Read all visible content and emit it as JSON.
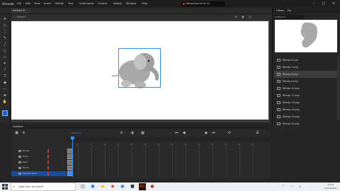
{
  "app": {
    "logo": "Animate",
    "menu": [
      "File",
      "Edit",
      "View",
      "Insert",
      "Modify",
      "Text",
      "Commands",
      "Control",
      "Debug",
      "Window",
      "Help"
    ],
    "recording": "Recording 00:01:11"
  },
  "document": {
    "tab_label": "Untitled-3*",
    "scene_label": "Scene 1"
  },
  "right_panel": {
    "tabs": [
      "Library",
      "Pro"
    ],
    "library_select": "Untitled-3",
    "items": [
      {
        "name": "Bitmap 6.png",
        "selected": false
      },
      {
        "name": "Bitmap 7.png",
        "selected": false
      },
      {
        "name": "Bitmap 8.png",
        "selected": true
      },
      {
        "name": "Bitmap 9.png",
        "selected": false
      },
      {
        "name": "Bitmap 10.png",
        "selected": false
      },
      {
        "name": "Bitmap 11.png",
        "selected": false
      },
      {
        "name": "Bitmap 12.png",
        "selected": false
      },
      {
        "name": "Bitmap 13.png",
        "selected": false
      },
      {
        "name": "Bitmap 14.png",
        "selected": false
      },
      {
        "name": "Bitmap 15.png",
        "selected": false
      }
    ]
  },
  "timeline": {
    "title": "Timeline",
    "fps": "24.00 FPS",
    "ruler": [
      "1s",
      "5",
      "10",
      "15",
      "20",
      "25",
      "30",
      "35",
      "40",
      "45",
      "50",
      "55",
      "60",
      "65"
    ],
    "layers": [
      {
        "name": "Rocket",
        "selected": false
      },
      {
        "name": "trunk",
        "selected": false
      },
      {
        "name": "Eyes",
        "selected": false
      },
      {
        "name": "Mouth",
        "selected": false
      },
      {
        "name": "Elephant Body",
        "selected": true
      }
    ]
  },
  "taskbar": {
    "search_placeholder": "Type here to search",
    "time": "13:14",
    "date": "01/12/2021"
  },
  "colors": {
    "accent": "#3b8cf5",
    "stage": "#ffffff",
    "workspace": "#262626",
    "elephant": "#a8a8a8"
  }
}
